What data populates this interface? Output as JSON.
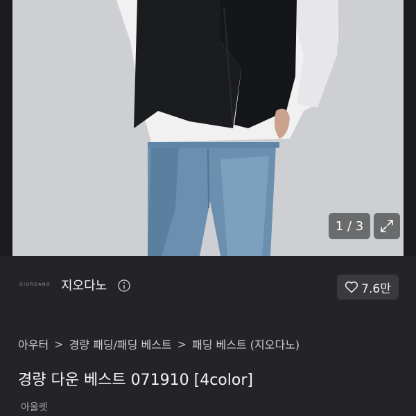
{
  "gallery": {
    "counter": "1 / 3",
    "expand_icon": "expand-icon"
  },
  "brand": {
    "logo_text": "GIORDANO",
    "name": "지오다노",
    "info_icon": "info-icon"
  },
  "likes": {
    "count": "7.6만",
    "icon": "heart-icon"
  },
  "breadcrumb": {
    "items": [
      "아우터",
      "경량 패딩/패딩 베스트",
      "패딩 베스트 (지오다노)"
    ],
    "separator": ">"
  },
  "product": {
    "title": "경량 다운 베스트 071910 [4color]",
    "subtitle": "아울렛"
  },
  "colors": {
    "background": "#242426",
    "photo_bg": "#cfd0d4",
    "button_bg": "#3a3a3d"
  }
}
